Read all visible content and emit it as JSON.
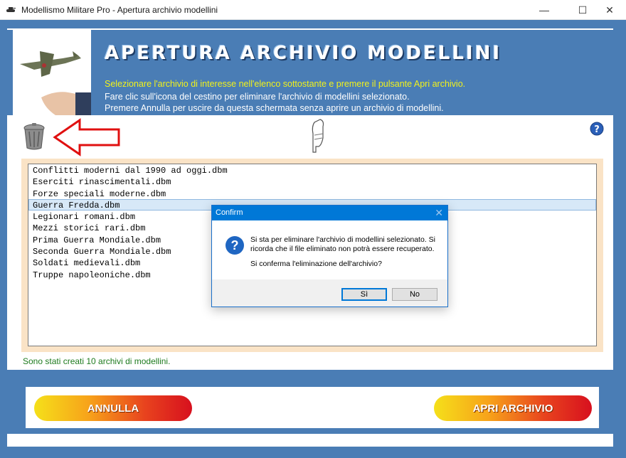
{
  "window": {
    "title": "Modellismo Militare Pro - Apertura archivio modellini",
    "min_glyph": "—",
    "max_glyph": "☐",
    "close_glyph": "✕"
  },
  "header": {
    "title": "APERTURA ARCHIVIO MODELLINI",
    "line1": "Selezionare l'archivio di interesse nell'elenco sottostante e premere il pulsante Apri archivio.",
    "line2": "Fare clic sull'icona del cestino per eliminare l'archivio di modellini selezionato.",
    "line3": "Premere Annulla per uscire da questa schermata senza aprire un archivio di modellini."
  },
  "icons": {
    "trash": "trash-icon",
    "arrow": "red-arrow-icon",
    "hand": "pointing-hand-icon",
    "help": "help-icon",
    "question": "?"
  },
  "archives": {
    "items": [
      "Conflitti moderni dal 1990 ad oggi.dbm",
      "Eserciti rinascimentali.dbm",
      "Forze speciali moderne.dbm",
      "Guerra Fredda.dbm",
      "Legionari romani.dbm",
      "Mezzi storici rari.dbm",
      "Prima Guerra Mondiale.dbm",
      "Seconda Guerra Mondiale.dbm",
      "Soldati medievali.dbm",
      "Truppe napoleoniche.dbm"
    ],
    "selected_index": 3
  },
  "status": "Sono stati creati 10 archivi di modellini.",
  "buttons": {
    "cancel": "ANNULLA",
    "open": "APRI ARCHIVIO"
  },
  "dialog": {
    "title": "Confirm",
    "close_glyph": "✕",
    "message_line1": "Si sta per eliminare l'archivio di modellini selezionato. Si",
    "message_line2": "ricorda che il file eliminato non potrà essere recuperato.",
    "message_line3": "Si conferma l'eliminazione dell'archivio?",
    "yes": "Sì",
    "no": "No"
  },
  "colors": {
    "header_blue": "#4a7db5",
    "highlight_yellow": "#f2f21a",
    "status_green": "#1e7b1e",
    "list_frame": "#fae3c6",
    "dialog_accent": "#0078d7"
  }
}
